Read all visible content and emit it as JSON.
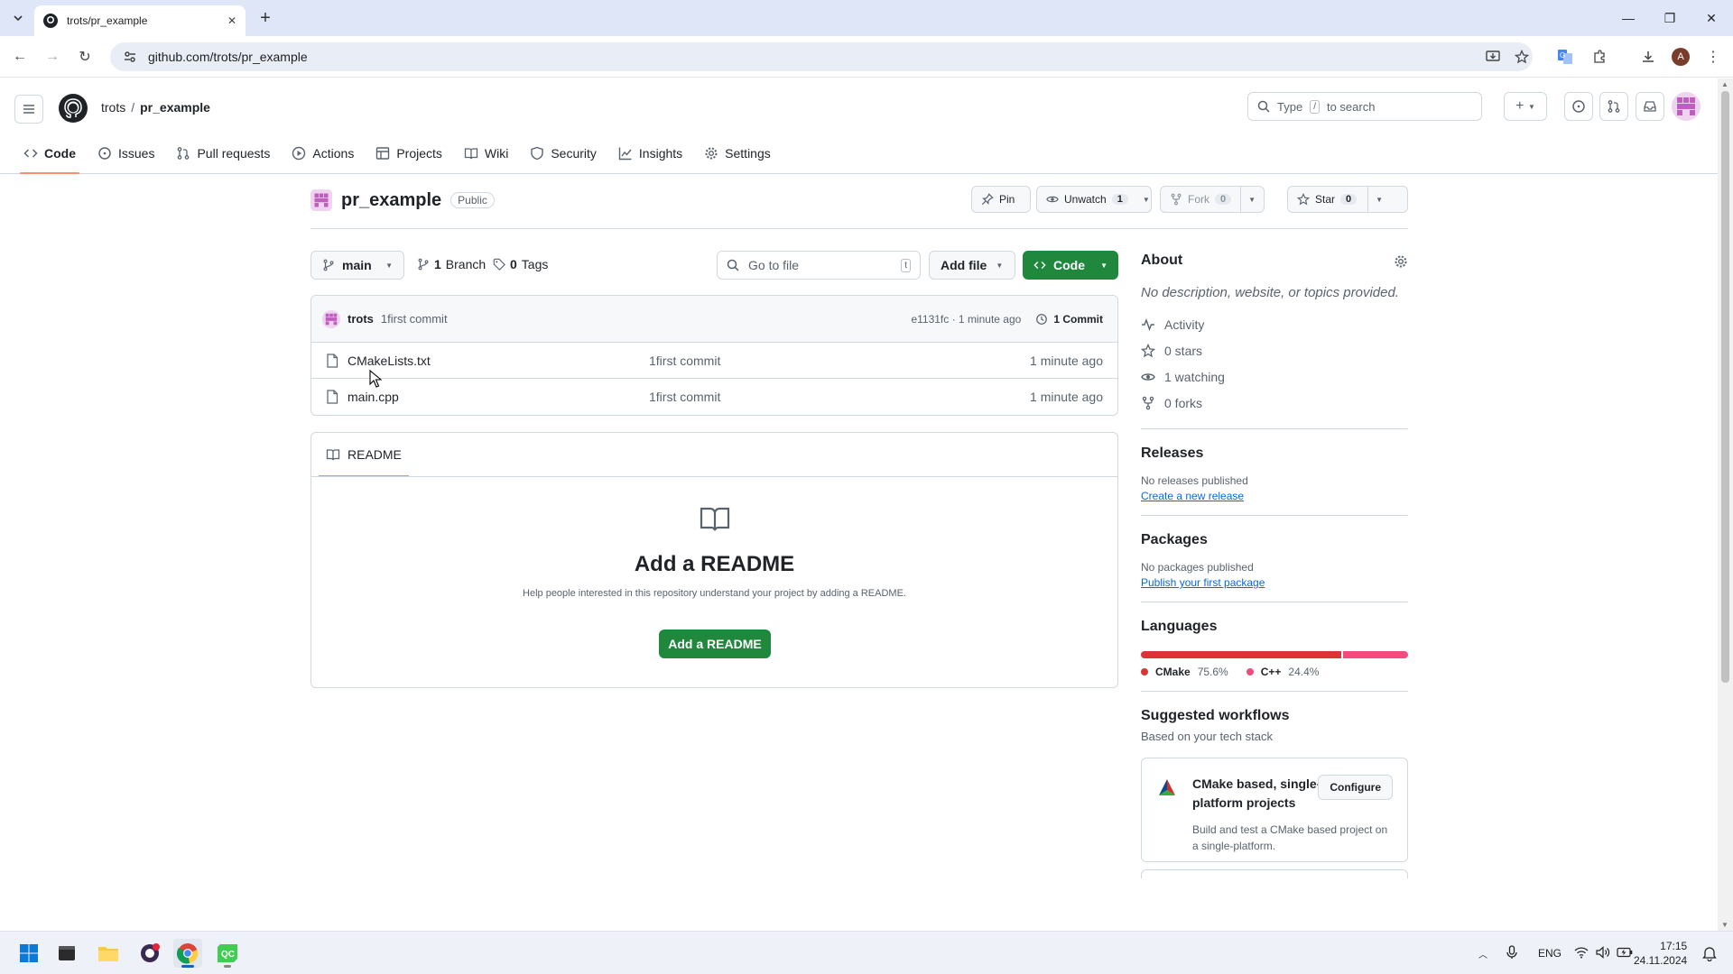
{
  "browser": {
    "tab_title": "trots/pr_example",
    "url": "github.com/trots/pr_example",
    "profile_initial": "A"
  },
  "header": {
    "owner": "trots",
    "separator": "/",
    "repo": "pr_example",
    "search_placeholder_pre": "Type",
    "search_key": "/",
    "search_placeholder_post": "to search"
  },
  "repo_nav": [
    {
      "label": "Code",
      "icon": "code-icon"
    },
    {
      "label": "Issues",
      "icon": "issue-icon"
    },
    {
      "label": "Pull requests",
      "icon": "pull-request-icon"
    },
    {
      "label": "Actions",
      "icon": "play-icon"
    },
    {
      "label": "Projects",
      "icon": "table-icon"
    },
    {
      "label": "Wiki",
      "icon": "book-icon"
    },
    {
      "label": "Security",
      "icon": "shield-icon"
    },
    {
      "label": "Insights",
      "icon": "graph-icon"
    },
    {
      "label": "Settings",
      "icon": "gear-icon"
    }
  ],
  "repo_header": {
    "name": "pr_example",
    "visibility": "Public",
    "pin_label": "Pin",
    "unwatch_label": "Unwatch",
    "watch_count": "1",
    "fork_label": "Fork",
    "fork_count": "0",
    "star_label": "Star",
    "star_count": "0"
  },
  "branch_bar": {
    "branch": "main",
    "branches_count": "1",
    "branches_label": "Branch",
    "tags_count": "0",
    "tags_label": "Tags",
    "goto_placeholder": "Go to file",
    "goto_key": "t",
    "add_file_label": "Add file",
    "code_label": "Code"
  },
  "latest_commit": {
    "author": "trots",
    "message": "1first commit",
    "sha_time": "e1131fc · 1 minute ago",
    "commits_label": "1 Commit"
  },
  "files": [
    {
      "name": "CMakeLists.txt",
      "message": "1first commit",
      "age": "1 minute ago"
    },
    {
      "name": "main.cpp",
      "message": "1first commit",
      "age": "1 minute ago"
    }
  ],
  "readme": {
    "tab_label": "README",
    "heading": "Add a README",
    "text": "Help people interested in this repository understand your project by adding a README.",
    "button": "Add a README"
  },
  "sidebar": {
    "about_title": "About",
    "description": "No description, website, or topics provided.",
    "stats": [
      {
        "label": "Activity",
        "icon": "pulse-icon"
      },
      {
        "label": "0 stars",
        "icon": "star-icon"
      },
      {
        "label": "1 watching",
        "icon": "eye-icon"
      },
      {
        "label": "0 forks",
        "icon": "fork-icon"
      }
    ],
    "releases_title": "Releases",
    "releases_text": "No releases published",
    "releases_link": "Create a new release",
    "packages_title": "Packages",
    "packages_text": "No packages published",
    "packages_link": "Publish your first package",
    "languages_title": "Languages",
    "languages": [
      {
        "name": "CMake",
        "percent": "75.6%",
        "share": 75.6,
        "color": "#da3434"
      },
      {
        "name": "C++",
        "percent": "24.4%",
        "share": 24.4,
        "color": "#f34b7d"
      }
    ],
    "workflows_title": "Suggested workflows",
    "workflows_subtitle": "Based on your tech stack",
    "workflow": {
      "title": "CMake based, single-platform projects",
      "description": "Build and test a CMake based project on a single-platform.",
      "button": "Configure"
    }
  },
  "taskbar": {
    "lang": "ENG",
    "time": "17:15",
    "date": "24.11.2024"
  }
}
